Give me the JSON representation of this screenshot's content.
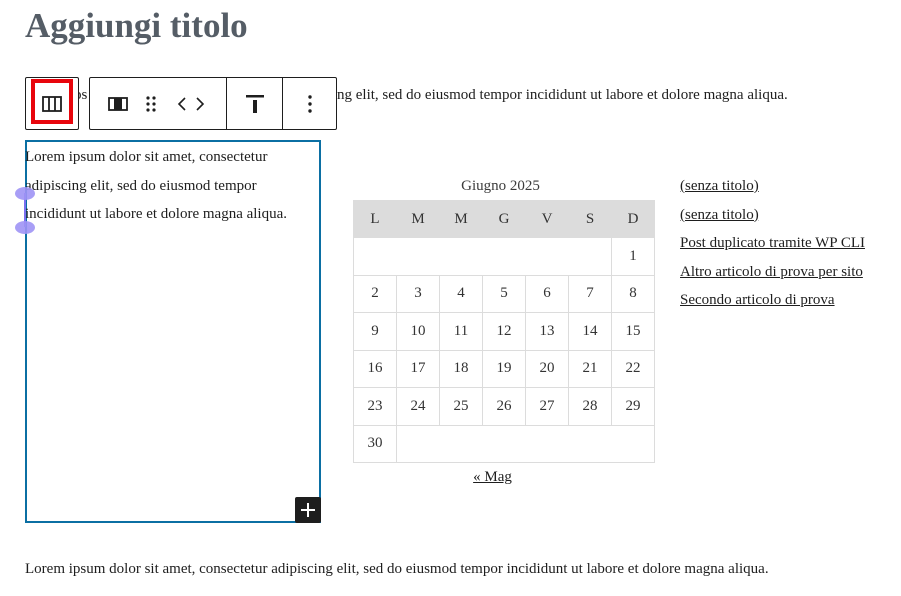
{
  "editor": {
    "title": "Aggiungi titolo",
    "paragraph_top": {
      "prefix": "Lorem ipsum dolor sit amet, consectetur adipiscing elit, sed do eiusmod tempor incididunt ut labore et dolore magna aliqua.",
      "visible_left": "os",
      "visible_right": "ng elit, sed do eiusmod tempor incididunt ut labore et dolore magna aliqua."
    },
    "column_text": "Lorem ipsum dolor sit amet, consectetur adipiscing elit, sed do eiusmod tempor incididunt ut labore et dolore magna aliqua.",
    "paragraph_bottom": "Lorem ipsum dolor sit amet, consectetur adipiscing elit, sed do eiusmod tempor incididunt ut labore et dolore magna aliqua."
  },
  "toolbar": {
    "parent_icon": "columns-icon",
    "buttons": [
      {
        "name": "column-icon"
      },
      {
        "name": "drag-handle-icon"
      },
      {
        "name": "move-left-icon"
      },
      {
        "name": "move-right-icon"
      },
      {
        "name": "align-top-icon"
      },
      {
        "name": "more-options-icon"
      }
    ],
    "highlight_color": "#e8050c"
  },
  "calendar": {
    "caption": "Giugno 2025",
    "weekdays": [
      "L",
      "M",
      "M",
      "G",
      "V",
      "S",
      "D"
    ],
    "weeks": [
      [
        "",
        "",
        "",
        "",
        "",
        "",
        "1"
      ],
      [
        "2",
        "3",
        "4",
        "5",
        "6",
        "7",
        "8"
      ],
      [
        "9",
        "10",
        "11",
        "12",
        "13",
        "14",
        "15"
      ],
      [
        "16",
        "17",
        "18",
        "19",
        "20",
        "21",
        "22"
      ],
      [
        "23",
        "24",
        "25",
        "26",
        "27",
        "28",
        "29"
      ],
      [
        "30",
        "",
        "",
        "",
        "",
        "",
        ""
      ]
    ],
    "prev_link": "« Mag"
  },
  "latest_posts": [
    "(senza titolo)",
    "(senza titolo)",
    "Post duplicato tramite WP CLI",
    "Altro articolo di prova per sito",
    "Secondo articolo di prova"
  ],
  "colors": {
    "selection_border": "#0b6fa3",
    "handle": "#9f93f5"
  }
}
